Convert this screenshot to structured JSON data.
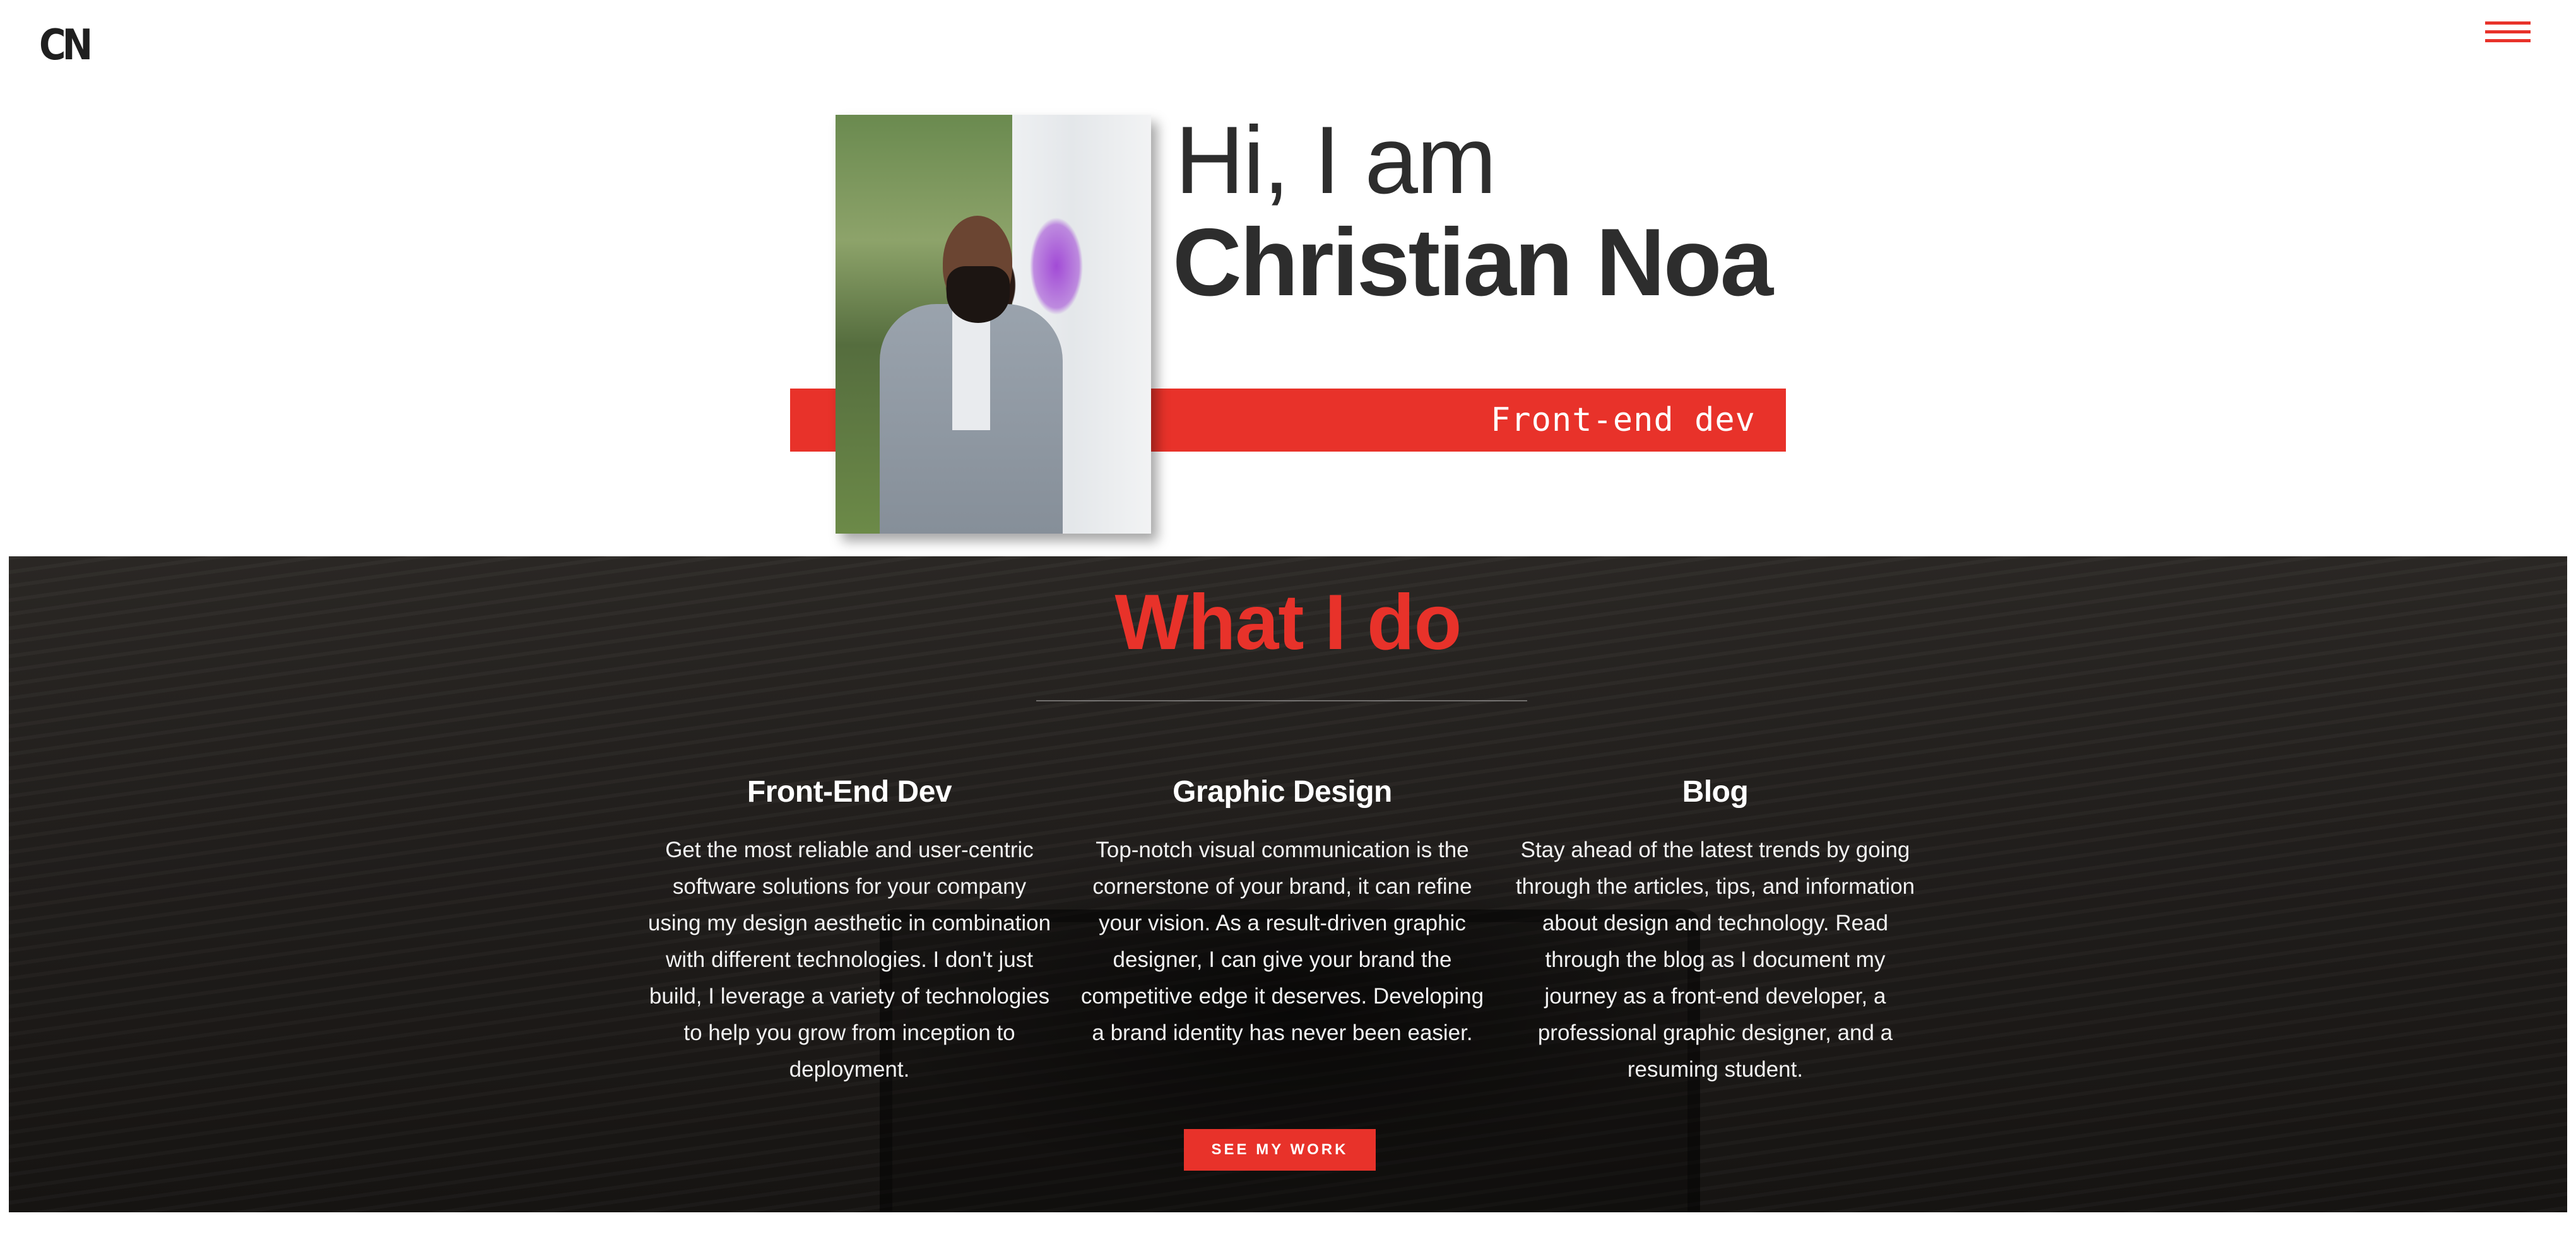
{
  "header": {
    "logo_text": "CN",
    "menu_icon": "hamburger-menu-icon"
  },
  "hero": {
    "greeting": "Hi, I am",
    "name": "Christian Noa",
    "role": "Front-end dev"
  },
  "services": {
    "title": "What I do",
    "items": [
      {
        "heading": "Front-End Dev",
        "text": "Get the most reliable and user-centric software solutions for your company using my design aesthetic in combination with different technologies. I don't just build, I leverage a variety of technologies to help you grow from inception to deployment."
      },
      {
        "heading": "Graphic Design",
        "text": "Top-notch visual communication is the cornerstone of your brand, it can refine your vision. As a result-driven graphic designer, I can give your brand the competitive edge it deserves. Developing a brand identity has never been easier."
      },
      {
        "heading": "Blog",
        "text": "Stay ahead of the latest trends by going through the articles, tips, and information about design and technology. Read through the blog as I document my journey as a front-end developer, a professional graphic designer, and a resuming student."
      }
    ],
    "cta_label": "SEE MY WORK"
  },
  "colors": {
    "accent": "#e8322a",
    "text_dark": "#2d2d2d",
    "section_bg": "#221f1c"
  }
}
